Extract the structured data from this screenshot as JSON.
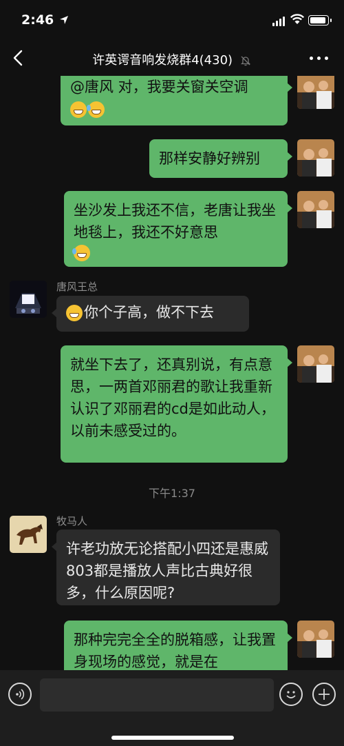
{
  "status_bar": {
    "time": "2:46"
  },
  "header": {
    "title": "许英谔音响发烧群4(430)"
  },
  "messages": [
    {
      "side": "right",
      "text": "@唐风 对，我要关窗关空调",
      "emojis": [
        "grin-icon",
        "laugh-cry-icon"
      ]
    },
    {
      "side": "right",
      "text": "那样安静好辨别"
    },
    {
      "side": "right",
      "text": "坐沙发上我还不信，老唐让我坐地毯上，我还不好意思",
      "emojis": [
        "laugh-cry-icon"
      ]
    },
    {
      "side": "left",
      "sender": "唐风王总",
      "text": "你个子高，做不下去",
      "emojis": [
        "grin-icon"
      ]
    },
    {
      "side": "right",
      "text": "就坐下去了，还真别说，有点意思，一两首邓丽君的歌让我重新认识了邓丽君的cd是如此动人，以前未感受过的。"
    },
    {
      "side": "left",
      "sender": "牧马人",
      "text": "许老功放无论搭配小四还是惠威803都是播放人声比古典好很多，什么原因呢?"
    },
    {
      "side": "right",
      "text": "那种完完全全的脱箱感，让我置身现场的感觉，就是在"
    }
  ],
  "timestamp": "下午1:37",
  "colors": {
    "bubble_self": "#5fb66a",
    "bubble_other": "#2b2b2b",
    "background": "#111111"
  },
  "input": {
    "placeholder": ""
  }
}
